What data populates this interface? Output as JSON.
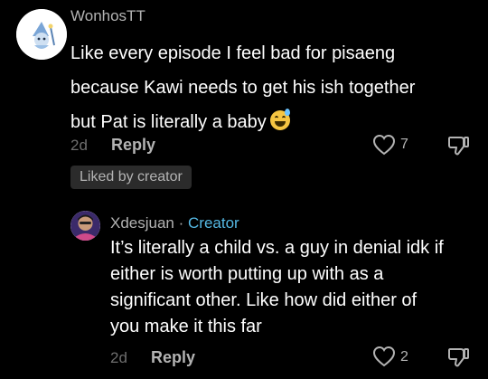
{
  "colors": {
    "background": "#000000",
    "text_primary": "#ffffff",
    "text_secondary": "#b3b3b3",
    "text_muted": "#6e6e6e",
    "creator_accent": "#55b8e3",
    "badge_bg": "#2b2b2b"
  },
  "comment": {
    "username": "WonhosTT",
    "text_lines": [
      "Like every episode I feel bad for pisaeng",
      "because Kawi needs to get his ish together",
      "but Pat is literally a baby"
    ],
    "emoji_icon": "grinning-face-with-sweat-emoji",
    "date": "2d",
    "reply_label": "Reply",
    "like_count": "7",
    "liked_badge": "Liked by creator"
  },
  "reply": {
    "username": "Xdesjuan",
    "separator": "·",
    "role": "Creator",
    "text_lines": [
      "It’s literally a child vs. a guy in denial idk if",
      "either is worth putting up with as a",
      "significant other. Like how did either of",
      "you make it this far"
    ],
    "date": "2d",
    "reply_label": "Reply",
    "like_count": "2"
  }
}
